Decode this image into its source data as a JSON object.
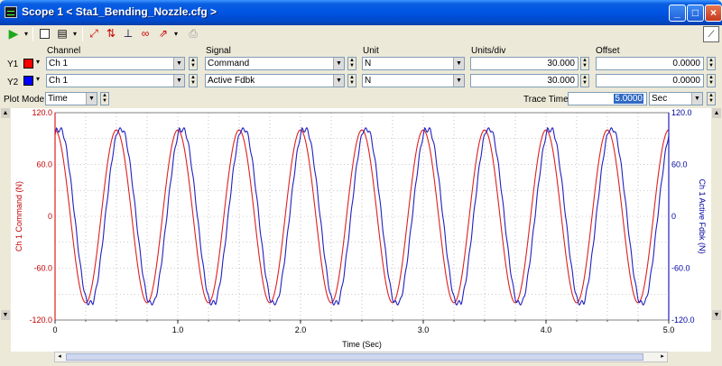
{
  "window": {
    "title": "Scope  1 < Sta1_Bending_Nozzle.cfg >"
  },
  "toolbar": {
    "icons": [
      "play-icon",
      "dropdown-arrow-icon",
      "stop-square-icon",
      "properties-icon",
      "zoom-fit-icon",
      "zoom-icon",
      "marker-icon",
      "lissajous-icon",
      "trace-icon",
      "print-icon",
      "chart-settings-icon"
    ]
  },
  "headers": {
    "channel": "Channel",
    "signal": "Signal",
    "unit": "Unit",
    "units_div": "Units/div",
    "offset": "Offset"
  },
  "traces": [
    {
      "label": "Y1",
      "color": "#ff0000",
      "channel": "Ch 1",
      "signal": "Command",
      "unit": "N",
      "units_div": "30.000",
      "offset": "0.0000"
    },
    {
      "label": "Y2",
      "color": "#0000ff",
      "channel": "Ch 1",
      "signal": "Active Fdbk",
      "unit": "N",
      "units_div": "30.000",
      "offset": "0.0000"
    }
  ],
  "plot_mode": {
    "label": "Plot Mode:",
    "value": "Time"
  },
  "trace_time": {
    "label": "Trace Time:",
    "value": "5.0000",
    "unit": "Sec"
  },
  "chart_data": {
    "type": "line",
    "xlabel": "Time (Sec)",
    "ylabel_left": "Ch 1 Command (N)",
    "ylabel_right": "Ch 1 Active Fdbk (N)",
    "xlim": [
      0,
      5
    ],
    "ylim": [
      -120,
      120
    ],
    "x_ticks": [
      "0",
      "1.0",
      "2.0",
      "3.0",
      "4.0",
      "5.0"
    ],
    "y_ticks_left": [
      "120.0",
      "60.0",
      "0",
      "-60.0",
      "-120.0"
    ],
    "y_ticks_right": [
      "120.0",
      "60.0",
      "0",
      "-60.0",
      "-120.0"
    ],
    "grid": true,
    "series": [
      {
        "name": "Command",
        "color": "#e02020",
        "frequency_hz": 2,
        "amplitude": 100,
        "phase_sec": 0
      },
      {
        "name": "Active Fdbk",
        "color": "#2020c0",
        "frequency_hz": 2,
        "amplitude": 100,
        "phase_sec": 0.035
      }
    ]
  }
}
